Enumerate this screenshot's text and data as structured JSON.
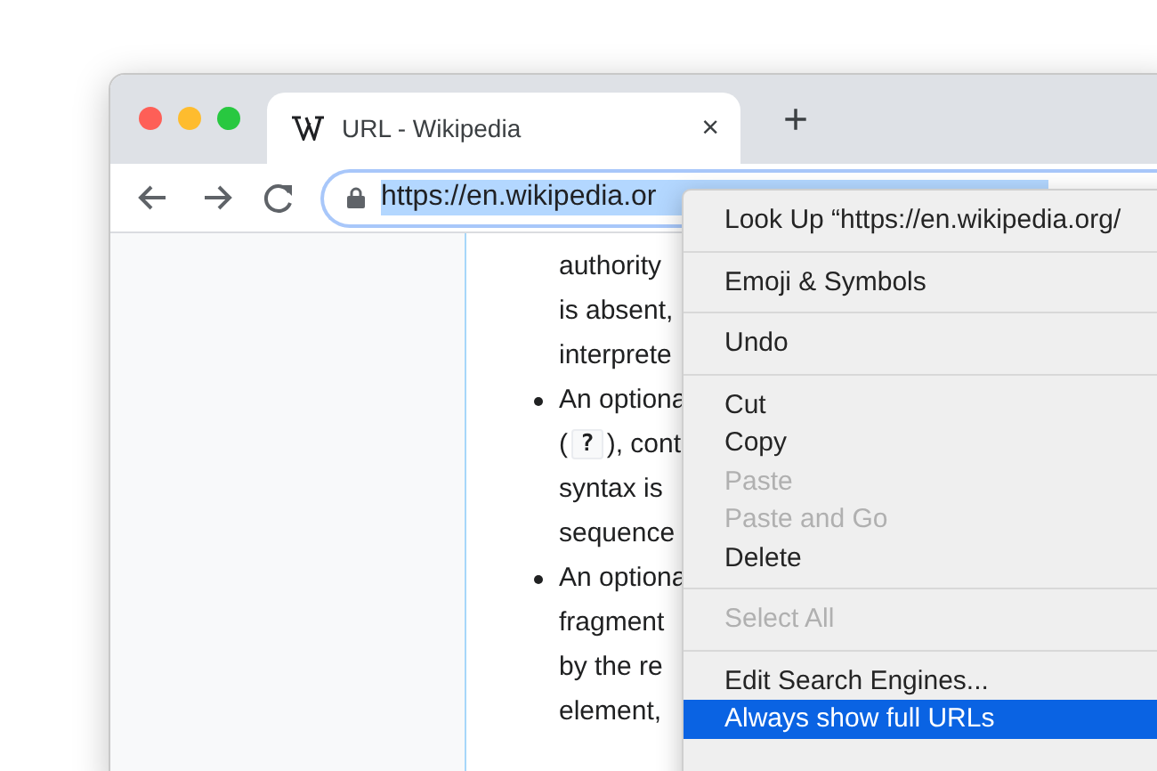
{
  "window": {
    "traffic_lights": [
      {
        "color": "#fe5f57"
      },
      {
        "color": "#febc2e"
      },
      {
        "color": "#28c840"
      }
    ]
  },
  "tabs": [
    {
      "title": "URL - Wikipedia",
      "close": "×",
      "selected": true
    }
  ],
  "new_tab": "+",
  "address_bar": {
    "value": "https://en.wikipedia.or",
    "text_selected": true
  },
  "article": {
    "lines": [
      {
        "text": "authority",
        "bullet": false
      },
      {
        "text": "is absent,",
        "bullet": false
      },
      {
        "text": "interprete",
        "bullet": false
      },
      {
        "text": "An optiona",
        "bullet": true
      },
      {
        "kind": "code",
        "before": "(",
        "code": "?",
        "after": "), cont",
        "bullet": false
      },
      {
        "text": "syntax is",
        "bullet": false
      },
      {
        "text": "sequence",
        "bullet": false
      },
      {
        "text": "An optiona",
        "bullet": true
      },
      {
        "text": "fragment",
        "bullet": false
      },
      {
        "text": "by the re",
        "bullet": false
      },
      {
        "text": "element,",
        "bullet": false
      }
    ]
  },
  "context_menu": {
    "groups": [
      [
        {
          "label": "Look Up “https://en.wikipedia.org/",
          "disabled": false,
          "selected": false
        }
      ],
      [
        {
          "label": "Emoji & Symbols",
          "disabled": false,
          "selected": false
        }
      ],
      [
        {
          "label": "Undo",
          "disabled": false,
          "selected": false
        }
      ],
      [
        {
          "label": "Cut",
          "disabled": false,
          "selected": false
        },
        {
          "label": "Copy",
          "disabled": false,
          "selected": false
        },
        {
          "label": "Paste",
          "disabled": true,
          "selected": false
        },
        {
          "label": "Paste and Go",
          "disabled": true,
          "selected": false
        },
        {
          "label": "Delete",
          "disabled": false,
          "selected": false
        }
      ],
      [
        {
          "label": "Select All",
          "disabled": true,
          "selected": false
        }
      ],
      [
        {
          "label": "Edit Search Engines...",
          "disabled": false,
          "selected": false
        },
        {
          "label": "Always show full URLs",
          "disabled": false,
          "selected": true
        }
      ]
    ]
  }
}
